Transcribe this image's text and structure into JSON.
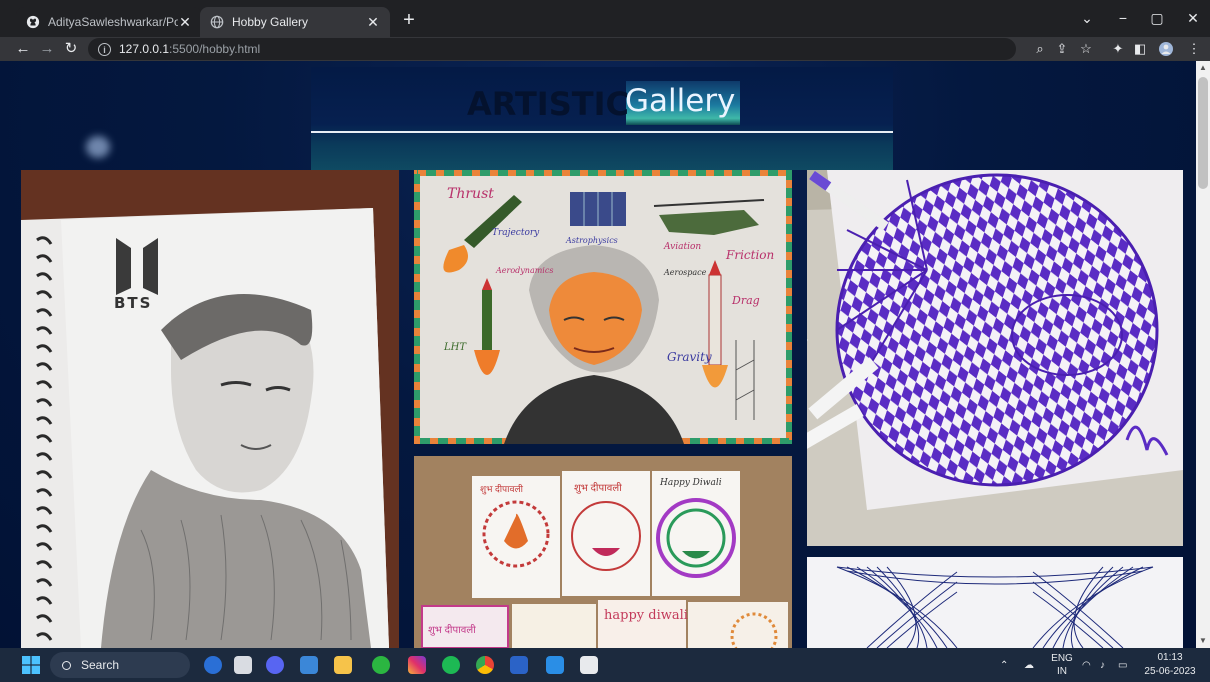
{
  "browser": {
    "tabs": [
      {
        "title": "AdityaSawleshwarkar/Portfolio",
        "icon": "github-icon",
        "active": false
      },
      {
        "title": "Hobby Gallery",
        "icon": "globe-icon",
        "active": true
      }
    ],
    "new_tab_symbol": "+",
    "window_controls": {
      "tab_search": "⌄",
      "minimize": "−",
      "restore": "▢",
      "close": "✕"
    },
    "url_host": "127.0.0.1",
    "url_path": ":5500/hobby.html"
  },
  "page": {
    "title_bold": "ARTISTIC",
    "title_light": "Gallery",
    "artworks": [
      {
        "name": "bts-pencil-sketch",
        "label": "BTS"
      },
      {
        "name": "kalam-tribute-poster",
        "words": [
          "Thrust",
          "Trajectory",
          "Astrophysics",
          "Aviation",
          "Friction",
          "Aerospace",
          "Aerodynamics",
          "Drag",
          "Gravity",
          "LHT"
        ]
      },
      {
        "name": "purple-op-art-drawing"
      },
      {
        "name": "diwali-greeting-cards",
        "cards": [
          "शुभ दीपावली",
          "शुभ दीपावली",
          "Happy Diwali",
          "शुभ दीपावली",
          "happy diwali"
        ]
      },
      {
        "name": "string-art-drawing"
      }
    ]
  },
  "taskbar": {
    "search_label": "Search",
    "language": "ENG",
    "region": "IN",
    "time": "01:13",
    "date": "25-06-2023"
  },
  "colors": {
    "page_bg": "#021235",
    "tab_bar": "#202124",
    "toolbar": "#35363a",
    "taskbar": "#1c2a3e"
  }
}
